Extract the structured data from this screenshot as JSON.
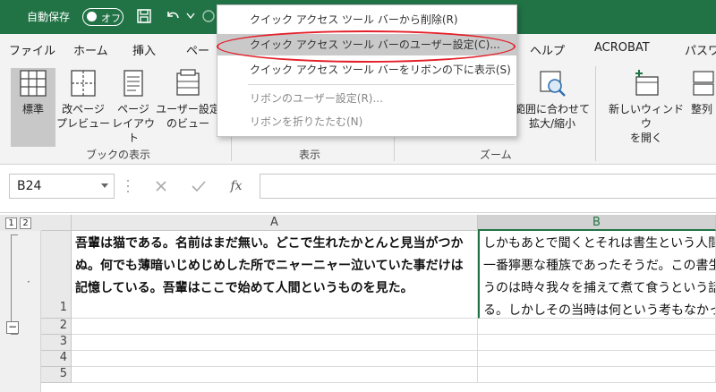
{
  "titlebar": {
    "autosave_label": "自動保存",
    "autosave_state": "オフ",
    "bg_color": "#217346"
  },
  "tabs": [
    "ファイル",
    "ホーム",
    "挿入",
    "ペー",
    "ヘルプ",
    "ACROBAT",
    "パスワ"
  ],
  "ribbon": {
    "buttons": [
      {
        "label": "標準",
        "icon": "normal-view-icon"
      },
      {
        "label": "改ページ\nプレビュー",
        "icon": "page-break-preview-icon"
      },
      {
        "label": "ページ\nレイアウト",
        "icon": "page-layout-icon"
      },
      {
        "label": "ユーザー設定\nのビュー",
        "icon": "custom-views-icon"
      },
      {
        "label": "範囲に合わせて\n拡大/縮小",
        "icon": "zoom-to-selection-icon"
      },
      {
        "label": "新しいウィンドウ\nを開く",
        "icon": "new-window-icon"
      },
      {
        "label": "整列",
        "icon": "arrange-all-icon"
      }
    ],
    "groups": [
      "ブックの表示",
      "表示",
      "ズーム"
    ]
  },
  "formula_bar": {
    "name_box": "B24",
    "fx_label": "fx",
    "value": ""
  },
  "sheet": {
    "outline_levels": [
      "1",
      "2"
    ],
    "columns": [
      "A",
      "B"
    ],
    "rows": [
      "1",
      "2",
      "3",
      "4",
      "5"
    ],
    "cells": {
      "A1": "吾輩は猫である。名前はまだ無い。どこで生れたかとんと見当がつかぬ。何でも薄暗いじめじめした所でニャーニャー泣いていた事だけは記憶している。吾輩はここで始めて人間というものを見た。",
      "B1": "しかもあとで聞くとそれは書生という人間中で一番獰悪な種族であったそうだ。この書生というのは時々我々を捕えて煮て食うという話である。しかしその当時は何という考もなかったから別段恐しいとも思わなかった。"
    },
    "outline_dot": "·",
    "outline_minus": "−"
  },
  "context_menu": {
    "items": [
      {
        "label": "クイック アクセス ツール バーから削除(R)",
        "state": "normal"
      },
      {
        "label": "クイック アクセス ツール バーのユーザー設定(C)...",
        "state": "highlighted"
      },
      {
        "label": "クイック アクセス ツール バーをリボンの下に表示(S)",
        "state": "normal"
      },
      {
        "label": "リボンのユーザー設定(R)...",
        "state": "dim"
      },
      {
        "label": "リボンを折りたたむ(N)",
        "state": "dim"
      }
    ],
    "annotation_color": "#e3202a"
  }
}
